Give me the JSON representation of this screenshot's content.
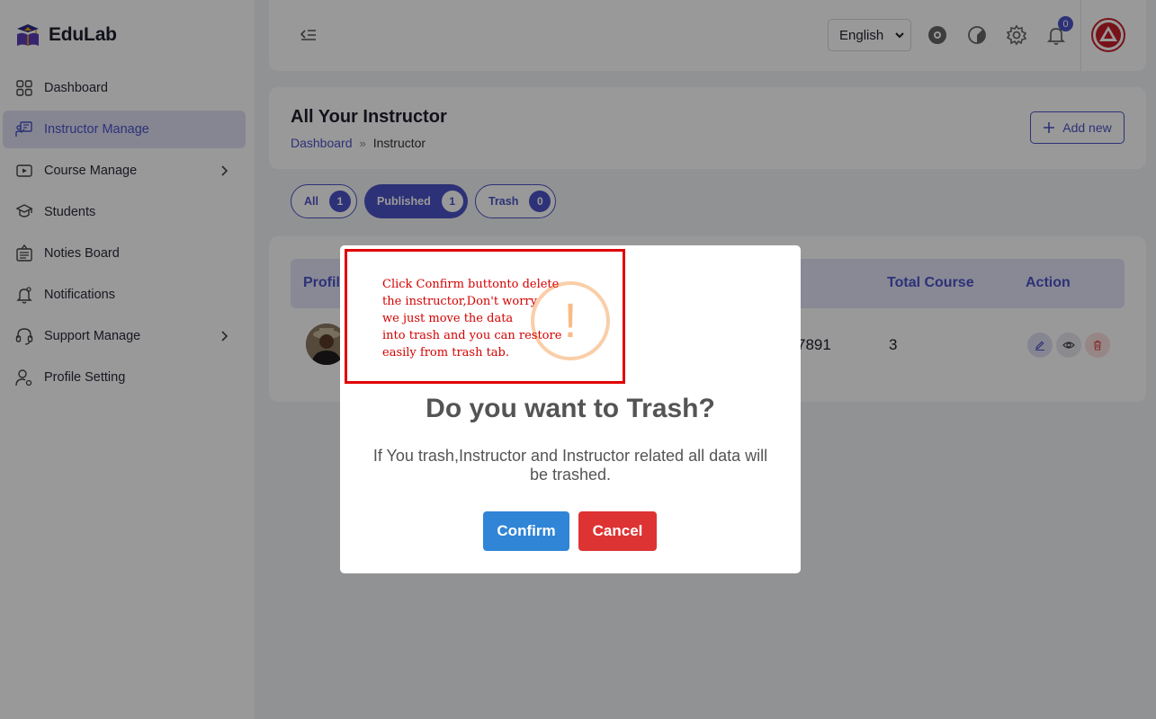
{
  "app": {
    "name": "EduLab"
  },
  "sidebar": {
    "items": [
      {
        "label": "Dashboard",
        "icon": "grid-icon",
        "active": false,
        "has_children": false
      },
      {
        "label": "Instructor Manage",
        "icon": "instructor-board-icon",
        "active": true,
        "has_children": false
      },
      {
        "label": "Course Manage",
        "icon": "video-icon",
        "active": false,
        "has_children": true
      },
      {
        "label": "Students",
        "icon": "graduation-cap-icon",
        "active": false,
        "has_children": false
      },
      {
        "label": "Noties Board",
        "icon": "notice-board-icon",
        "active": false,
        "has_children": false
      },
      {
        "label": "Notifications",
        "icon": "bell-icon",
        "active": false,
        "has_children": false
      },
      {
        "label": "Support Manage",
        "icon": "headset-icon",
        "active": false,
        "has_children": true
      },
      {
        "label": "Profile Setting",
        "icon": "user-gear-icon",
        "active": false,
        "has_children": false
      }
    ]
  },
  "topbar": {
    "language": "English",
    "notification_count": "0",
    "icons": [
      "collapse-menu-icon",
      "eye-icon",
      "theme-toggle-icon",
      "settings-gear-icon",
      "bell-icon"
    ]
  },
  "header": {
    "title": "All Your Instructor",
    "breadcrumb": {
      "home": "Dashboard",
      "separator": "»",
      "current": "Instructor"
    },
    "add_button": "Add new"
  },
  "tabs": [
    {
      "label": "All",
      "count": "1",
      "selected": false
    },
    {
      "label": "Published",
      "count": "1",
      "selected": true
    },
    {
      "label": "Trash",
      "count": "0",
      "selected": false
    }
  ],
  "table": {
    "headers": {
      "profile": "Profil",
      "total_course": "Total Course",
      "action": "Action"
    },
    "rows": [
      {
        "phone_partial": "7891",
        "total_course": "3"
      }
    ]
  },
  "modal": {
    "icon": "!",
    "title": "Do you want to Trash?",
    "text": "If You trash,Instructor and Instructor related all data will be trashed.",
    "confirm": "Confirm",
    "cancel": "Cancel"
  },
  "annotation": {
    "lines": [
      "Click Confirm buttonto delete",
      "the instructor,Don't  worry",
      "we just move the data",
      "into trash and you can restore",
      "easily from trash tab."
    ]
  },
  "colors": {
    "primary": "#4b53c6",
    "confirm": "#3085d6",
    "cancel": "#dd3333",
    "warning": "#f8bb86",
    "annotation": "#e00000"
  }
}
